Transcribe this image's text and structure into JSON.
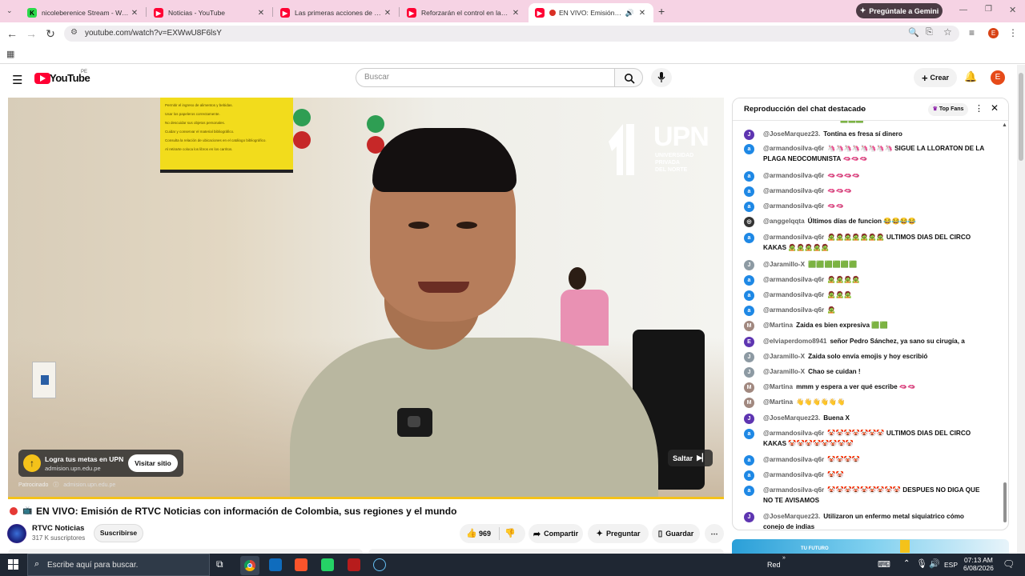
{
  "browser": {
    "tabs": [
      {
        "title": "nicoleberenice Stream - Watch",
        "favicon": "kick-icon",
        "color": "#2bd94a"
      },
      {
        "title": "Noticias - YouTube",
        "favicon": "youtube-icon",
        "color": "#ff0033"
      },
      {
        "title": "Las primeras acciones de Keiko",
        "favicon": "youtube-icon",
        "color": "#ff0033"
      },
      {
        "title": "Reforzarán el control en las fro",
        "favicon": "youtube-icon",
        "color": "#ff0033"
      },
      {
        "title": "EN VIVO: Emisión de",
        "favicon": "youtube-icon",
        "color": "#ff0033"
      }
    ],
    "gemini_button": "Pregúntale a Gemini",
    "url": "youtube.com/watch?v=EXWwU8F6lsY",
    "profile_letter": "E"
  },
  "youtube": {
    "logo_text": "YouTube",
    "country_code": "PE",
    "search_placeholder": "Buscar",
    "create_label": "Crear",
    "avatar_letter": "E"
  },
  "video": {
    "ad_title": "Logra tus metas en UPN",
    "ad_domain": "admision.upn.edu.pe",
    "visit_button": "Visitar sitio",
    "sponsored_label": "Patrocinado",
    "sponsored_domain": "admision.upn.edu.pe",
    "skip_button": "Saltar",
    "brand_big": "UPN",
    "brand_lines": [
      "UNIVERSIDAD",
      "PRIVADA",
      "DEL NORTE"
    ],
    "sign_lines": [
      "Permitir el ingreso de alimentos y bebidas.",
      "Usar los papeleros correctamente.",
      "No descuidar sus objetos personales.",
      "Cuidar y conservar el material bibliográfico.",
      "Consulta la relación de ubicaciones en el catálogo bibliográfico.",
      "Al retirarte coloca los libros en los carritos."
    ]
  },
  "meta": {
    "title": "EN VIVO: Emisión de RTVC Noticias con información de Colombia, sus regiones y el mundo",
    "channel": "RTVC Noticias",
    "subscribers": "317 K suscriptores",
    "subscribe": "Suscribirse",
    "likes": "969",
    "share": "Compartir",
    "ask": "Preguntar",
    "save": "Guardar"
  },
  "chat": {
    "header": "Reproducción del chat destacado",
    "top_fans": "Top Fans",
    "messages": [
      {
        "avatar": "J",
        "color": "#5e35b1",
        "author": "@JoseMarquez23.",
        "text": "Tontina es fresa sí dinero",
        "emoji": ""
      },
      {
        "avatar": "a",
        "color": "#1e88e5",
        "author": "@armandosilva-q6r",
        "text": "SIGUE LA LLORATON DE LA PLAGA NEOCOMUNISTA",
        "emoji": "🦄🦄🦄🦄🦄🦄🦄🦄"
      },
      {
        "avatar": "a",
        "color": "#1e88e5",
        "author": "@armandosilva-q6r",
        "text": "",
        "emoji": "🫦🫦🫦🫦"
      },
      {
        "avatar": "a",
        "color": "#1e88e5",
        "author": "@armandosilva-q6r",
        "text": "",
        "emoji": "🫦🫦🫦"
      },
      {
        "avatar": "a",
        "color": "#1e88e5",
        "author": "@armandosilva-q6r",
        "text": "",
        "emoji": "🫦🫦"
      },
      {
        "avatar": "◎",
        "color": "#333333",
        "author": "@anggelqqta",
        "text": "Últimos días de funcion",
        "emoji": "😂😂😂😂"
      },
      {
        "avatar": "a",
        "color": "#1e88e5",
        "author": "@armandosilva-q6r",
        "text": "ULTIMOS DIAS DEL CIRCO KAKAS",
        "emoji": "🧟🧟🧟🧟🧟🧟🧟"
      },
      {
        "avatar": "J",
        "color": "#8d9aa3",
        "author": "@Jaramillo-X",
        "text": "",
        "emoji": "🟩🟩🟩🟩🟩🟩"
      },
      {
        "avatar": "a",
        "color": "#1e88e5",
        "author": "@armandosilva-q6r",
        "text": "",
        "emoji": "🧟🧟🧟🧟"
      },
      {
        "avatar": "a",
        "color": "#1e88e5",
        "author": "@armandosilva-q6r",
        "text": "",
        "emoji": "🧟🧟🧟"
      },
      {
        "avatar": "a",
        "color": "#1e88e5",
        "author": "@armandosilva-q6r",
        "text": "",
        "emoji": "🧟"
      },
      {
        "avatar": "M",
        "color": "#a1887f",
        "author": "@Martina",
        "text": "Zaida es bien expresiva",
        "emoji": "🟩🟩"
      },
      {
        "avatar": "E",
        "color": "#5e35b1",
        "author": "@elviaperdomo8941",
        "text": "señor Pedro Sánchez, ya sano su cirugía, a",
        "emoji": ""
      },
      {
        "avatar": "J",
        "color": "#8d9aa3",
        "author": "@Jaramillo-X",
        "text": "Zaida solo envía emojis y hoy escribió",
        "emoji": ""
      },
      {
        "avatar": "J",
        "color": "#8d9aa3",
        "author": "@Jaramillo-X",
        "text": "Chao se cuidan !",
        "emoji": ""
      },
      {
        "avatar": "M",
        "color": "#a1887f",
        "author": "@Martina",
        "text": "mmm y espera a ver qué escribe",
        "emoji": "🫦🫦"
      },
      {
        "avatar": "M",
        "color": "#a1887f",
        "author": "@Martina",
        "text": "",
        "emoji": "👋👋👋👋👋👋"
      },
      {
        "avatar": "J",
        "color": "#5e35b1",
        "author": "@JoseMarquez23.",
        "text": "Buena X",
        "emoji": ""
      },
      {
        "avatar": "a",
        "color": "#1e88e5",
        "author": "@armandosilva-q6r",
        "text": "ULTIMOS DIAS DEL CIRCO KAKAS",
        "emoji": "🤡🤡🤡🤡🤡🤡🤡"
      },
      {
        "avatar": "a",
        "color": "#1e88e5",
        "author": "@armandosilva-q6r",
        "text": "",
        "emoji": "🤡🤡🤡🤡"
      },
      {
        "avatar": "a",
        "color": "#1e88e5",
        "author": "@armandosilva-q6r",
        "text": "",
        "emoji": "🤡🤡"
      },
      {
        "avatar": "a",
        "color": "#1e88e5",
        "author": "@armandosilva-q6r",
        "text": "DESPUES NO DIGA QUE NO TE AVISAMOS",
        "emoji": "🤡🤡🤡🤡🤡🤡🤡🤡🤡"
      },
      {
        "avatar": "J",
        "color": "#5e35b1",
        "author": "@JoseMarquez23.",
        "text": "Utilizaron un enfermo metal siquiatrico cómo conejo de indias",
        "emoji": ""
      }
    ]
  },
  "promo": {
    "text": "TU FUTURO"
  },
  "taskbar": {
    "search_placeholder": "Escribe aquí para buscar.",
    "network": "Red",
    "language": "ESP",
    "time": "07:13 AM",
    "date": "6/08/2026"
  }
}
